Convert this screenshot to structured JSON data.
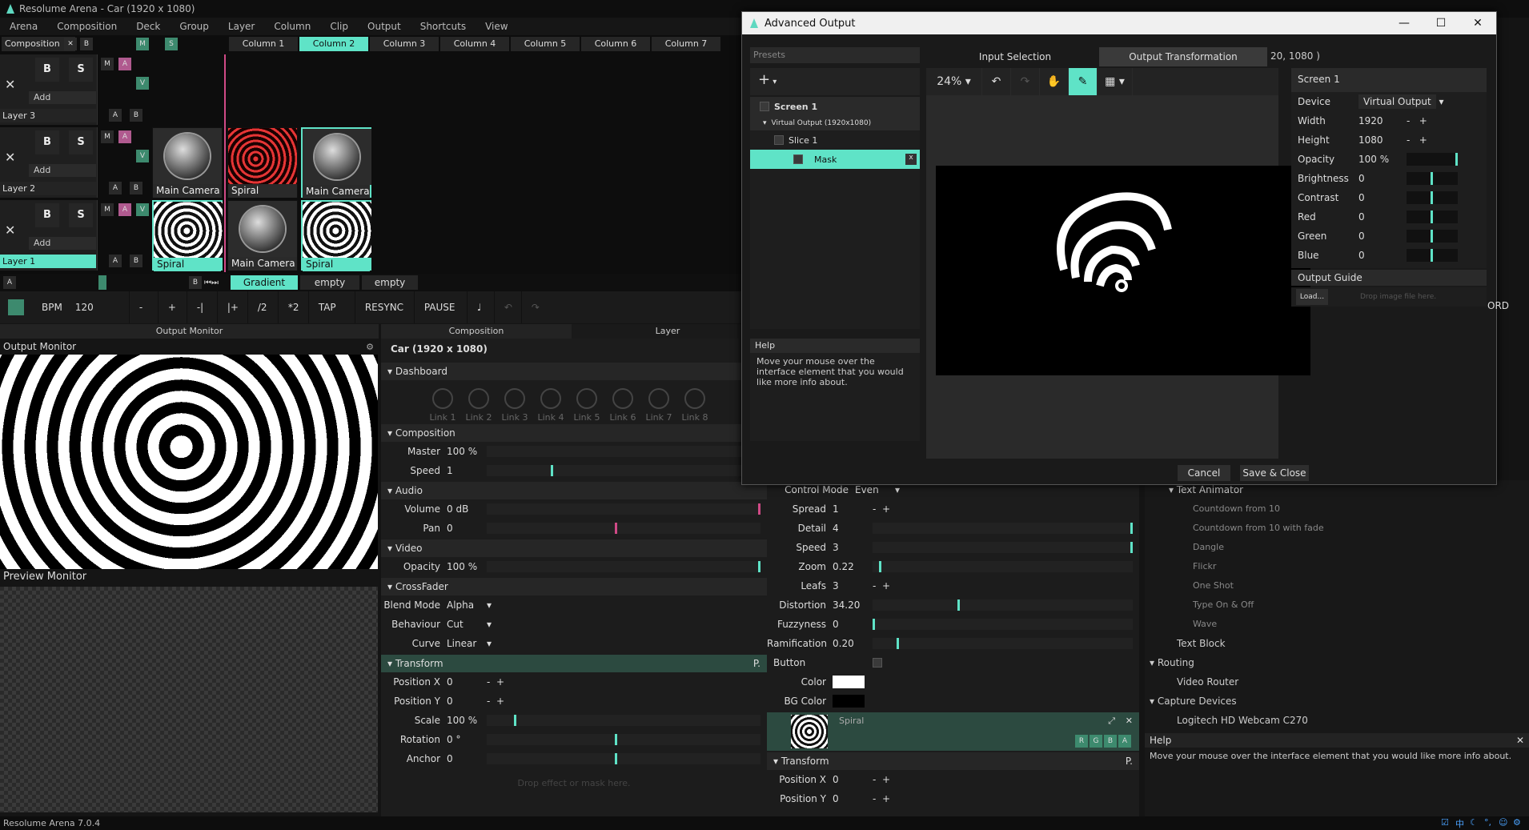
{
  "app": {
    "title": "Resolume Arena - Car (1920 x 1080)",
    "version": "Resolume Arena 7.0.4"
  },
  "menu": [
    "Arena",
    "Composition",
    "Deck",
    "Group",
    "Layer",
    "Column",
    "Clip",
    "Output",
    "Shortcuts",
    "View"
  ],
  "composition_label": "Composition",
  "columns": [
    "Column 1",
    "Column 2",
    "Column 3",
    "Column 4",
    "Column 5",
    "Column 6",
    "Column 7"
  ],
  "layers": [
    {
      "name": "Layer 3",
      "add": "Add",
      "clips": []
    },
    {
      "name": "Layer 2",
      "add": "Add",
      "clips": [
        "Main Camera",
        "Spiral",
        "Main Camera"
      ]
    },
    {
      "name": "Layer 1",
      "add": "Add",
      "clips": [
        "Spiral",
        "Main Camera",
        "Spiral"
      ]
    }
  ],
  "layer_buttons": {
    "b": "B",
    "s": "S",
    "m": "M",
    "a": "A",
    "v": "V",
    "close": "✕"
  },
  "decks": [
    "Gradient",
    "empty",
    "empty"
  ],
  "transport": {
    "bpm_label": "BPM",
    "bpm": "120",
    "minus": "-",
    "plus": "+",
    "nudge_left": "-|",
    "nudge_right": "|+",
    "half": "/2",
    "double": "*2",
    "tap": "TAP",
    "resync": "RESYNC",
    "pause": "PAUSE"
  },
  "monitors": {
    "output_header": "Output Monitor",
    "output_label": "Output Monitor",
    "preview_label": "Preview Monitor"
  },
  "tabs": {
    "composition": "Composition",
    "layer": "Layer"
  },
  "comp_title": "Car (1920 x 1080)",
  "dashboard": {
    "label": "Dashboard",
    "links": [
      "Link 1",
      "Link 2",
      "Link 3",
      "Link 4",
      "Link 5",
      "Link 6",
      "Link 7",
      "Link 8"
    ]
  },
  "composition_sec": {
    "label": "Composition",
    "master_label": "Master",
    "master": "100 %",
    "speed_label": "Speed",
    "speed": "1"
  },
  "audio": {
    "label": "Audio",
    "volume_label": "Volume",
    "volume": "0 dB",
    "pan_label": "Pan",
    "pan": "0"
  },
  "video": {
    "label": "Video",
    "opacity_label": "Opacity",
    "opacity": "100 %"
  },
  "crossfader": {
    "label": "CrossFader",
    "blend_label": "Blend Mode",
    "blend": "Alpha",
    "behaviour_label": "Behaviour",
    "behaviour": "Cut",
    "curve_label": "Curve",
    "curve": "Linear"
  },
  "transform": {
    "label": "Transform",
    "p": "P.",
    "posx_label": "Position X",
    "posx": "0",
    "posy_label": "Position Y",
    "posy": "0",
    "scale_label": "Scale",
    "scale": "100 %",
    "rotation_label": "Rotation",
    "rotation": "0 °",
    "anchor_label": "Anchor",
    "anchor": "0",
    "drop": "Drop effect or mask here."
  },
  "effect": {
    "control_mode_label": "Control Mode",
    "control_mode": "Even",
    "spread_label": "Spread",
    "spread": "1",
    "detail_label": "Detail",
    "detail": "4",
    "speed_label": "Speed",
    "speed": "3",
    "zoom_label": "Zoom",
    "zoom": "0.22",
    "leafs_label": "Leafs",
    "leafs": "3",
    "distortion_label": "Distortion",
    "distortion": "34.20",
    "fuzzy_label": "Fuzzyness",
    "fuzzy": "0",
    "ram_label": "Ramification",
    "ram": "0.20",
    "button_label": "Button",
    "color_label": "Color",
    "bgcolor_label": "BG Color",
    "clip_name": "Spiral",
    "rgba": [
      "R",
      "G",
      "B",
      "A"
    ],
    "transform_label": "Transform",
    "posx_label": "Position X",
    "posx": "0",
    "posy_label": "Position Y",
    "posy": "0",
    "p": "P."
  },
  "library": {
    "text_animator": "Text Animator",
    "items": [
      "Countdown from 10",
      "Countdown from 10 with fade",
      "Dangle",
      "Flickr",
      "One Shot",
      "Type On & Off",
      "Wave"
    ],
    "text_block": "Text Block",
    "routing": "Routing",
    "video_router": "Video Router",
    "capture": "Capture Devices",
    "webcam": "Logitech HD Webcam C270",
    "help_title": "Help",
    "help_text": "Move your mouse over the interface element that you would like more info about."
  },
  "dialog": {
    "title": "Advanced Output",
    "presets": "Presets",
    "tab_input": "Input Selection",
    "tab_output": "Output Transformation",
    "dims_fragment": "20, 1080 )",
    "add": "+",
    "zoom": "24%",
    "tree": {
      "screen": "Screen 1",
      "virtual": "Virtual Output (1920x1080)",
      "slice": "Slice 1",
      "mask": "Mask"
    },
    "help_title": "Help",
    "help_text": "Move your mouse over the interface element that you would like more info about.",
    "right": {
      "header": "Screen 1",
      "device_label": "Device",
      "device": "Virtual Output",
      "width_label": "Width",
      "width": "1920",
      "height_label": "Height",
      "height": "1080",
      "opacity_label": "Opacity",
      "opacity": "100 %",
      "brightness_label": "Brightness",
      "brightness": "0",
      "contrast_label": "Contrast",
      "contrast": "0",
      "red_label": "Red",
      "red": "0",
      "green_label": "Green",
      "green": "0",
      "blue_label": "Blue",
      "blue": "0",
      "guide_label": "Output Guide",
      "load": "Load...",
      "drop": "Drop image file here."
    },
    "cancel": "Cancel",
    "save": "Save & Close",
    "ord_fragment": "ORD"
  }
}
